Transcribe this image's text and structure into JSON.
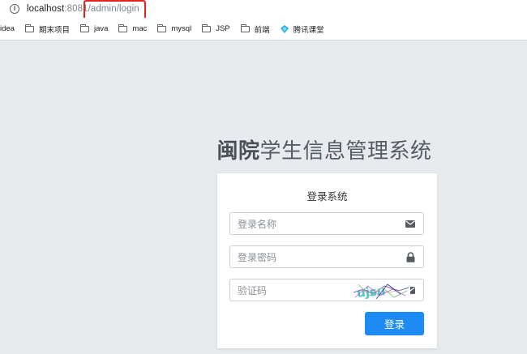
{
  "browser": {
    "url_host": "localhost",
    "url_port": ":8081",
    "url_path": "/admin/login"
  },
  "bookmarks": [
    {
      "label": "idea",
      "icon": "none"
    },
    {
      "label": "期末项目",
      "icon": "folder-icon"
    },
    {
      "label": "java",
      "icon": "folder-icon"
    },
    {
      "label": "mac",
      "icon": "folder-icon"
    },
    {
      "label": "mysql",
      "icon": "folder-icon"
    },
    {
      "label": "JSP",
      "icon": "folder-icon"
    },
    {
      "label": "前端",
      "icon": "folder-icon"
    },
    {
      "label": "腾讯课堂",
      "icon": "tencent-classroom-icon"
    }
  ],
  "page": {
    "title_strong": "闽院",
    "title_rest": "学生信息管理系统",
    "panel_title": "登录系统"
  },
  "form": {
    "username_placeholder": "登录名称",
    "password_placeholder": "登录密码",
    "captcha_placeholder": "验证码",
    "submit_label": "登录"
  },
  "colors": {
    "accent": "#1e8bf5",
    "highlight": "#e0261d",
    "background": "#e8ebee"
  }
}
